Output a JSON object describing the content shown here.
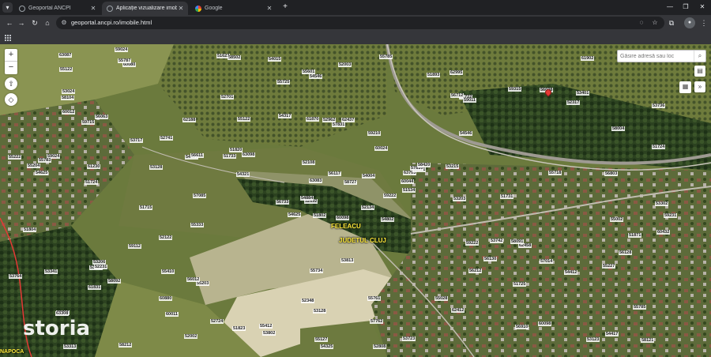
{
  "browser": {
    "tabs": [
      {
        "label": "Geoportal ANCPI",
        "active": false
      },
      {
        "label": "Aplicație vizualizare imobile",
        "active": true
      },
      {
        "label": "Google",
        "active": false
      }
    ],
    "url": "geoportal.ancpi.ro/imobile.html"
  },
  "map": {
    "search_placeholder": "Găsire adresă sau loc",
    "place_labels": {
      "feleacu": "FELEACU",
      "judetul_cluj": "JUDETUL CLUJ",
      "side": "NAPOCA"
    },
    "watermark": "storia",
    "parcels": [
      "60098",
      "59715",
      "52692",
      "62709",
      "63703",
      "55203",
      "62995",
      "62437",
      "51722",
      "59222",
      "60080",
      "58121",
      "51724",
      "53736",
      "54625",
      "54546",
      "58212",
      "61870",
      "60024",
      "58092",
      "63098",
      "60011",
      "52962",
      "53721",
      "62458",
      "56063",
      "54546",
      "54625",
      "59222",
      "51724",
      "54884",
      "52348",
      "63083",
      "62188",
      "59315",
      "56012",
      "53123",
      "55785",
      "58091",
      "55785",
      "51733",
      "53128",
      "56212",
      "52002",
      "55222",
      "60044",
      "53313",
      "53128",
      "51534",
      "61831",
      "58004",
      "56130",
      "62412",
      "60880",
      "55787",
      "63087",
      "55761",
      "53401",
      "52003",
      "57085",
      "59024",
      "52741",
      "56038",
      "59024",
      "51893",
      "55725",
      "56117",
      "53764",
      "55734",
      "51823",
      "53742",
      "54127",
      "63308",
      "55122",
      "53717",
      "51804",
      "52108",
      "57762",
      "54004",
      "53203",
      "56128",
      "55127",
      "56803",
      "53813",
      "60098",
      "52808",
      "55028",
      "55601",
      "59231",
      "53215",
      "51725",
      "58727",
      "55227",
      "55783",
      "54325",
      "56712",
      "59011",
      "51715",
      "51622",
      "53302",
      "55204",
      "59112",
      "55410",
      "52724",
      "57810",
      "52317",
      "54321",
      "55002",
      "58104",
      "57831",
      "56733",
      "58502",
      "53341",
      "51802",
      "54317",
      "54015",
      "53321",
      "61902",
      "59210",
      "55122",
      "51731",
      "52122",
      "54417",
      "53802",
      "55718",
      "60012",
      "52231",
      "53723",
      "56611",
      "52701",
      "51871",
      "57014",
      "55333",
      "53206",
      "60432",
      "51820",
      "54802",
      "61230",
      "54412",
      "52134",
      "58420",
      "53024",
      "55412",
      "56910"
    ]
  }
}
